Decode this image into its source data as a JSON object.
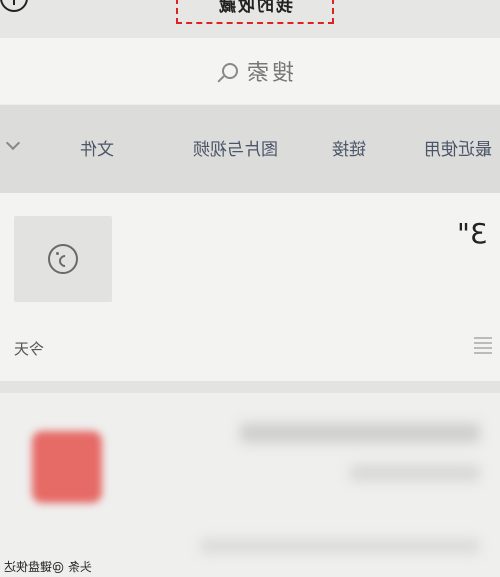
{
  "header": {
    "title": "我的收藏",
    "add_icon": "plus-circle-icon"
  },
  "search": {
    "label": "搜索",
    "icon": "search-icon"
  },
  "tabs": [
    {
      "label": "最近使用"
    },
    {
      "label": "链接"
    },
    {
      "label": "图片与视频"
    },
    {
      "label": "文件"
    }
  ],
  "favorite_item": {
    "title": "3\"",
    "date": "今天",
    "icon": "voice-message-icon"
  },
  "watermark": "头条 @键盘侠达"
}
